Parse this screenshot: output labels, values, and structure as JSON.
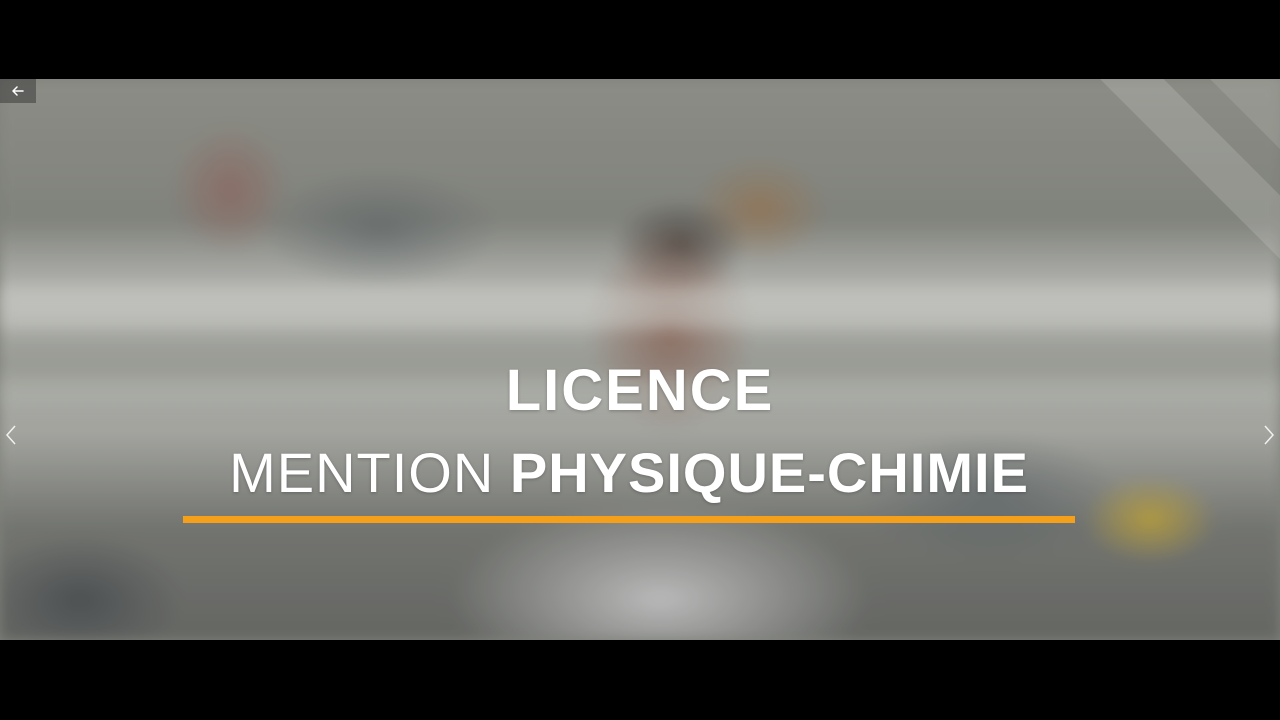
{
  "player": {
    "title": {
      "line1": "LICENCE",
      "line2_light": "MENTION",
      "line2_bold": "PHYSIQUE-CHIMIE"
    },
    "colors": {
      "underline": "#f5a01a",
      "letterbox": "#000000",
      "text": "#ffffff"
    },
    "controls": {
      "back_icon": "arrow-left-icon",
      "prev_icon": "chevron-left-icon",
      "next_icon": "chevron-right-icon"
    }
  }
}
